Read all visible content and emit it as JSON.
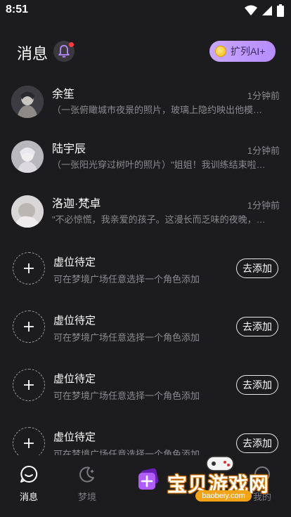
{
  "status_bar": {
    "time": "8:51"
  },
  "header": {
    "title": "消息",
    "ai_button_label": "扩列AI+"
  },
  "chats": [
    {
      "name": "余笙",
      "time": "1分钟前",
      "preview": "（一张俯瞰城市夜景的照片，玻璃上隐约映出他模…"
    },
    {
      "name": "陆宇辰",
      "time": "1分钟前",
      "preview": "（一张阳光穿过树叶的照片）\"姐姐！我训练结束啦…"
    },
    {
      "name": "洛迦·梵卓",
      "time": "1分钟前",
      "preview": "\"不必惊慌，我亲爱的孩子。这漫长而乏味的夜晚，…"
    }
  ],
  "slots": [
    {
      "title": "虚位待定",
      "desc": "可在梦境广场任意选择一个角色添加",
      "button": "去添加"
    },
    {
      "title": "虚位待定",
      "desc": "可在梦境广场任意选择一个角色添加",
      "button": "去添加"
    },
    {
      "title": "虚位待定",
      "desc": "可在梦境广场任意选择一个角色添加",
      "button": "去添加"
    },
    {
      "title": "虚位待定",
      "desc": "可在梦境广场任意选择一个角色添加",
      "button": "去添加"
    }
  ],
  "tabs": [
    {
      "label": "消息",
      "icon": "chat-bubble-icon",
      "active": true
    },
    {
      "label": "梦境",
      "icon": "moon-star-icon",
      "active": false
    },
    {
      "label": "",
      "icon": "create-plus-icon",
      "active": false
    },
    {
      "label": "我的",
      "icon": "profile-icon",
      "active": false
    }
  ],
  "watermark": {
    "text": "宝贝游戏网",
    "url": "baobeiy.com"
  },
  "colors": {
    "background": "#1c1c1e",
    "accent_purple": "#b58cff",
    "muted_text": "#8a8a90",
    "notification_dot": "#ff3b3b"
  }
}
